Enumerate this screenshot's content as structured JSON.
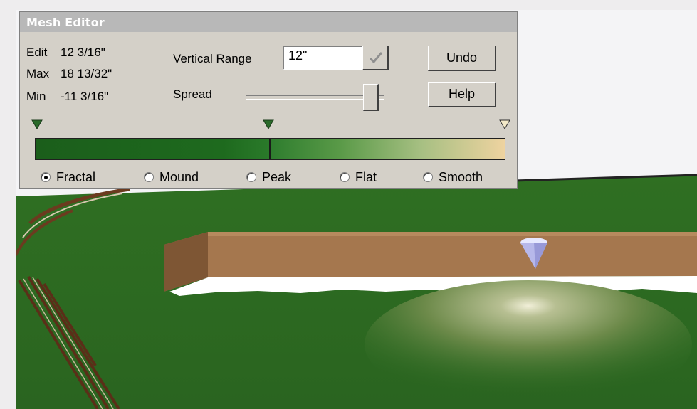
{
  "window": {
    "title": "Mesh Editor"
  },
  "stats": {
    "edit_label": "Edit",
    "edit_value": "12 3/16\"",
    "max_label": "Max",
    "max_value": "18 13/32\"",
    "min_label": "Min",
    "min_value": "-11 3/16\""
  },
  "vertical_range": {
    "label": "Vertical Range",
    "value": "12\""
  },
  "spread": {
    "label": "Spread",
    "slider_level": 0.9
  },
  "buttons": {
    "undo": "Undo",
    "help": "Help"
  },
  "gradient": {
    "start_color": "#1b5e1b",
    "mid_color": "#2e7d2e",
    "end_color": "#eed3a0",
    "marker_color": "#2a6a2a"
  },
  "modes": [
    {
      "label": "Fractal",
      "selected": true
    },
    {
      "label": "Mound",
      "selected": false
    },
    {
      "label": "Peak",
      "selected": false
    },
    {
      "label": "Flat",
      "selected": false
    },
    {
      "label": "Smooth",
      "selected": false
    }
  ],
  "scene": {
    "ground_color": "#2f6b22",
    "wall_color": "#a5774e",
    "cursor_icon": "cone-cursor-icon"
  }
}
